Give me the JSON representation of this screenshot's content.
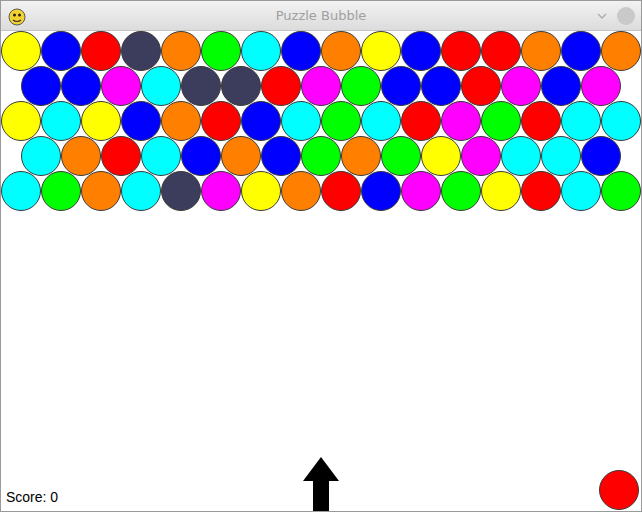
{
  "window": {
    "title": "Puzzle Bubble"
  },
  "grid": {
    "rows": [
      [
        {
          "color": "#ffff00"
        },
        {
          "color": "#0000ff"
        },
        {
          "color": "#ff0000"
        },
        {
          "color": "#3c3c5c"
        },
        {
          "color": "#ff8000"
        },
        {
          "color": "#00ff00"
        },
        {
          "color": "#00ffff"
        },
        {
          "color": "#0000ff"
        },
        {
          "color": "#ff8000"
        },
        {
          "color": "#ffff00"
        },
        {
          "color": "#0000ff"
        },
        {
          "color": "#ff0000"
        },
        {
          "color": "#ff0000"
        },
        {
          "color": "#ff8000"
        },
        {
          "color": "#0000ff"
        },
        {
          "color": "#ff8000"
        }
      ],
      [
        {
          "color": "#0000ff"
        },
        {
          "color": "#0000ff"
        },
        {
          "color": "#ff00ff"
        },
        {
          "color": "#00ffff"
        },
        {
          "color": "#3c3c5c"
        },
        {
          "color": "#3c3c5c"
        },
        {
          "color": "#ff0000"
        },
        {
          "color": "#ff00ff"
        },
        {
          "color": "#00ff00"
        },
        {
          "color": "#0000ff"
        },
        {
          "color": "#0000ff"
        },
        {
          "color": "#ff0000"
        },
        {
          "color": "#ff00ff"
        },
        {
          "color": "#0000ff"
        },
        {
          "color": "#ff00ff"
        }
      ],
      [
        {
          "color": "#ffff00"
        },
        {
          "color": "#00ffff"
        },
        {
          "color": "#ffff00"
        },
        {
          "color": "#0000ff"
        },
        {
          "color": "#ff8000"
        },
        {
          "color": "#ff0000"
        },
        {
          "color": "#0000ff"
        },
        {
          "color": "#00ffff"
        },
        {
          "color": "#00ff00"
        },
        {
          "color": "#00ffff"
        },
        {
          "color": "#ff0000"
        },
        {
          "color": "#ff00ff"
        },
        {
          "color": "#00ff00"
        },
        {
          "color": "#ff0000"
        },
        {
          "color": "#00ffff"
        },
        {
          "color": "#00ffff"
        }
      ],
      [
        {
          "color": "#00ffff"
        },
        {
          "color": "#ff8000"
        },
        {
          "color": "#ff0000"
        },
        {
          "color": "#00ffff"
        },
        {
          "color": "#0000ff"
        },
        {
          "color": "#ff8000"
        },
        {
          "color": "#0000ff"
        },
        {
          "color": "#00ff00"
        },
        {
          "color": "#ff8000"
        },
        {
          "color": "#00ff00"
        },
        {
          "color": "#ffff00"
        },
        {
          "color": "#ff00ff"
        },
        {
          "color": "#00ffff"
        },
        {
          "color": "#00ffff"
        },
        {
          "color": "#0000ff"
        }
      ],
      [
        {
          "color": "#00ffff"
        },
        {
          "color": "#00ff00"
        },
        {
          "color": "#ff8000"
        },
        {
          "color": "#00ffff"
        },
        {
          "color": "#3c3c5c"
        },
        {
          "color": "#ff00ff"
        },
        {
          "color": "#ffff00"
        },
        {
          "color": "#ff8000"
        },
        {
          "color": "#ff0000"
        },
        {
          "color": "#0000ff"
        },
        {
          "color": "#ff00ff"
        },
        {
          "color": "#00ff00"
        },
        {
          "color": "#ffff00"
        },
        {
          "color": "#ff0000"
        },
        {
          "color": "#00ffff"
        },
        {
          "color": "#00ff00"
        }
      ]
    ]
  },
  "score": "Score: 0",
  "next_bubble": {
    "color": "#ff0000"
  }
}
